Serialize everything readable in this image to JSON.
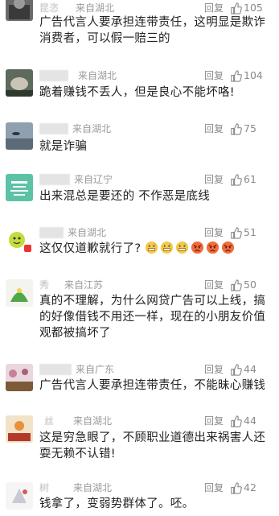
{
  "comments": [
    {
      "user": "昆恣",
      "location": "来自湖北",
      "reply": "回复",
      "likes": "105",
      "line1": "广告代言人要承担连带责任，这明显是欺诈",
      "line2": "消费者，可以假一赔三的"
    },
    {
      "user": "",
      "location": "来自湖北",
      "reply": "回复",
      "likes": "104",
      "line1": "跪着赚钱不丢人，但是良心不能坏咯!",
      "line2": ""
    },
    {
      "user": "",
      "location": "来自湖北",
      "reply": "回复",
      "likes": "75",
      "line1": "就是诈骗",
      "line2": ""
    },
    {
      "user": "",
      "location": "来自辽宁",
      "reply": "回复",
      "likes": "61",
      "line1": "出来混总是要还的 不作恶是底线",
      "line2": ""
    },
    {
      "user": "",
      "location": "来自湖北",
      "reply": "回复",
      "likes": "51",
      "line1": "这仅仅道歉就行了?",
      "line2": ""
    },
    {
      "user": "秀",
      "location": "来自江苏",
      "reply": "回复",
      "likes": "50",
      "line1": "真的不理解，为什么网贷广告可以上线，搞",
      "line2": "的好像借钱不用还一样，现在的小朋友价值",
      "line3": "观都被搞坏了"
    },
    {
      "user": "",
      "location": "来自广东",
      "reply": "回复",
      "likes": "44",
      "line1": "广告代言人要承担连带责任，不能昧心赚钱",
      "line2": ""
    },
    {
      "user": "丝",
      "location": "来自湖北",
      "reply": "回复",
      "likes": "44",
      "line1": "这是穷急眼了，不顾职业道德出来祸害人还",
      "line2": "耍无赖不认错!"
    },
    {
      "user": "树",
      "location": "来自湖北",
      "reply": "回复",
      "likes": "42",
      "line1": "钱拿了，变弱势群体了。呸。",
      "line2": ""
    }
  ],
  "icons": {
    "like": "thumbs-up-icon"
  },
  "emoji_row": [
    "grimace-emoji",
    "grimace-emoji",
    "grimace-emoji",
    "angry-face-emoji",
    "angry-face-emoji",
    "angry-face-emoji"
  ]
}
